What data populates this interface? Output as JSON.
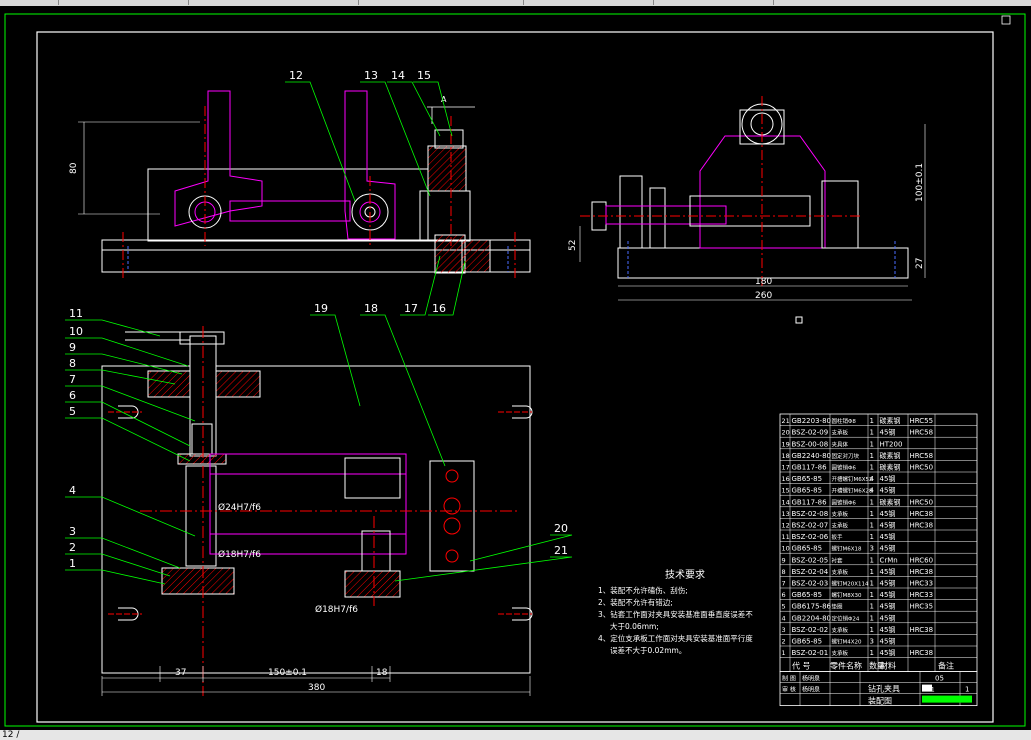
{
  "dimensions": {
    "front_height": "80",
    "side_height": "100±0.1",
    "side_left": "52",
    "side_right": "27",
    "side_inner_width": "180",
    "side_outer_width": "260",
    "section_a": "A",
    "plan_left": "37",
    "plan_mid": "150±0.1",
    "plan_right": "18",
    "plan_total": "380",
    "fit_24": "Ø24H7/f6",
    "fit_18a": "Ø18H7/f6",
    "fit_18b": "Ø18H7/f6"
  },
  "callouts": [
    "1",
    "2",
    "3",
    "4",
    "5",
    "6",
    "7",
    "8",
    "9",
    "10",
    "11",
    "12",
    "13",
    "14",
    "15",
    "16",
    "17",
    "18",
    "19",
    "20",
    "21"
  ],
  "tech_requirements": {
    "title": "技术要求",
    "items": [
      "1、装配不允许磕伤、刮伤;",
      "2、装配不允许有错边;",
      "3、钻套工作面对夹具安装基准面垂直度误差不",
      "大于0.06mm;",
      "4、定位支承板工作面对夹具安装基准面平行度",
      "误差不大于0.02mm。"
    ]
  },
  "bom": {
    "rows": [
      {
        "no": "21",
        "code": "GB2203-80",
        "name": "圆柱销Φ8",
        "qty": "1",
        "mat": "碳素钢",
        "note": "HRC55"
      },
      {
        "no": "20",
        "code": "BSZ-02-09",
        "name": "支承板",
        "qty": "1",
        "mat": "45钢",
        "note": "HRC58"
      },
      {
        "no": "19",
        "code": "BSZ-00-08",
        "name": "夹具体",
        "qty": "1",
        "mat": "HT200",
        "note": ""
      },
      {
        "no": "18",
        "code": "GB2240-80",
        "name": "固定对刀块",
        "qty": "1",
        "mat": "碳素钢",
        "note": "HRC58"
      },
      {
        "no": "17",
        "code": "GB117-86",
        "name": "圆锥销Φ6",
        "qty": "1",
        "mat": "碳素钢",
        "note": "HRC50"
      },
      {
        "no": "16",
        "code": "GB65-85",
        "name": "开槽螺钉M6X52",
        "qty": "4",
        "mat": "45钢",
        "note": ""
      },
      {
        "no": "15",
        "code": "GB65-85",
        "name": "开槽螺钉M6X28",
        "qty": "4",
        "mat": "45钢",
        "note": ""
      },
      {
        "no": "14",
        "code": "GB117-86",
        "name": "圆锥销Φ6",
        "qty": "1",
        "mat": "碳素钢",
        "note": "HRC50"
      },
      {
        "no": "13",
        "code": "BSZ-02-08",
        "name": "支承板",
        "qty": "1",
        "mat": "45钢",
        "note": "HRC38"
      },
      {
        "no": "12",
        "code": "BSZ-02-07",
        "name": "支承板",
        "qty": "1",
        "mat": "45钢",
        "note": "HRC38"
      },
      {
        "no": "11",
        "code": "BSZ-02-06",
        "name": "扳手",
        "qty": "1",
        "mat": "45钢",
        "note": ""
      },
      {
        "no": "10",
        "code": "GB65-85",
        "name": "螺钉M6X18",
        "qty": "3",
        "mat": "45钢",
        "note": ""
      },
      {
        "no": "9",
        "code": "BSZ-02-05",
        "name": "衬套",
        "qty": "1",
        "mat": "CrMn",
        "note": "HRC60"
      },
      {
        "no": "8",
        "code": "BSZ-02-04",
        "name": "支承板",
        "qty": "1",
        "mat": "45钢",
        "note": "HRC38"
      },
      {
        "no": "7",
        "code": "BSZ-02-03",
        "name": "螺钉M20X114",
        "qty": "1",
        "mat": "45钢",
        "note": "HRC33"
      },
      {
        "no": "6",
        "code": "GB65-85",
        "name": "螺钉M8X30",
        "qty": "1",
        "mat": "45钢",
        "note": "HRC33"
      },
      {
        "no": "5",
        "code": "GB6175-86",
        "name": "垫圈",
        "qty": "1",
        "mat": "45钢",
        "note": "HRC35"
      },
      {
        "no": "4",
        "code": "GB2204-80",
        "name": "定位销Φ24",
        "qty": "1",
        "mat": "45钢",
        "note": ""
      },
      {
        "no": "3",
        "code": "BSZ-02-02",
        "name": "支承板",
        "qty": "1",
        "mat": "45钢",
        "note": "HRC38"
      },
      {
        "no": "2",
        "code": "GB65-85",
        "name": "螺钉M4X20",
        "qty": "3",
        "mat": "45钢",
        "note": ""
      },
      {
        "no": "1",
        "code": "BSZ-02-01",
        "name": "支承板",
        "qty": "1",
        "mat": "45钢",
        "note": "HRC38"
      }
    ],
    "header": {
      "code": "代 号",
      "name": "零件名称",
      "qty": "数量",
      "mat": "材料",
      "note": "备注"
    },
    "title_block": {
      "label_row1": "制 图",
      "label_row2": "审 核",
      "label_row3": "",
      "name1": "杨明泉",
      "name2": "杨明泉",
      "part_name": "钻孔夹具",
      "drawing_type": "装配图",
      "sheet_no": "05",
      "scale": "1:1",
      "sheet": "1"
    }
  },
  "status_text": "12 /",
  "colors": {
    "white": "#ffffff",
    "magenta": "#ff00ff",
    "red": "#ff0000",
    "green": "#00ff00",
    "blue": "#4a6bff"
  }
}
